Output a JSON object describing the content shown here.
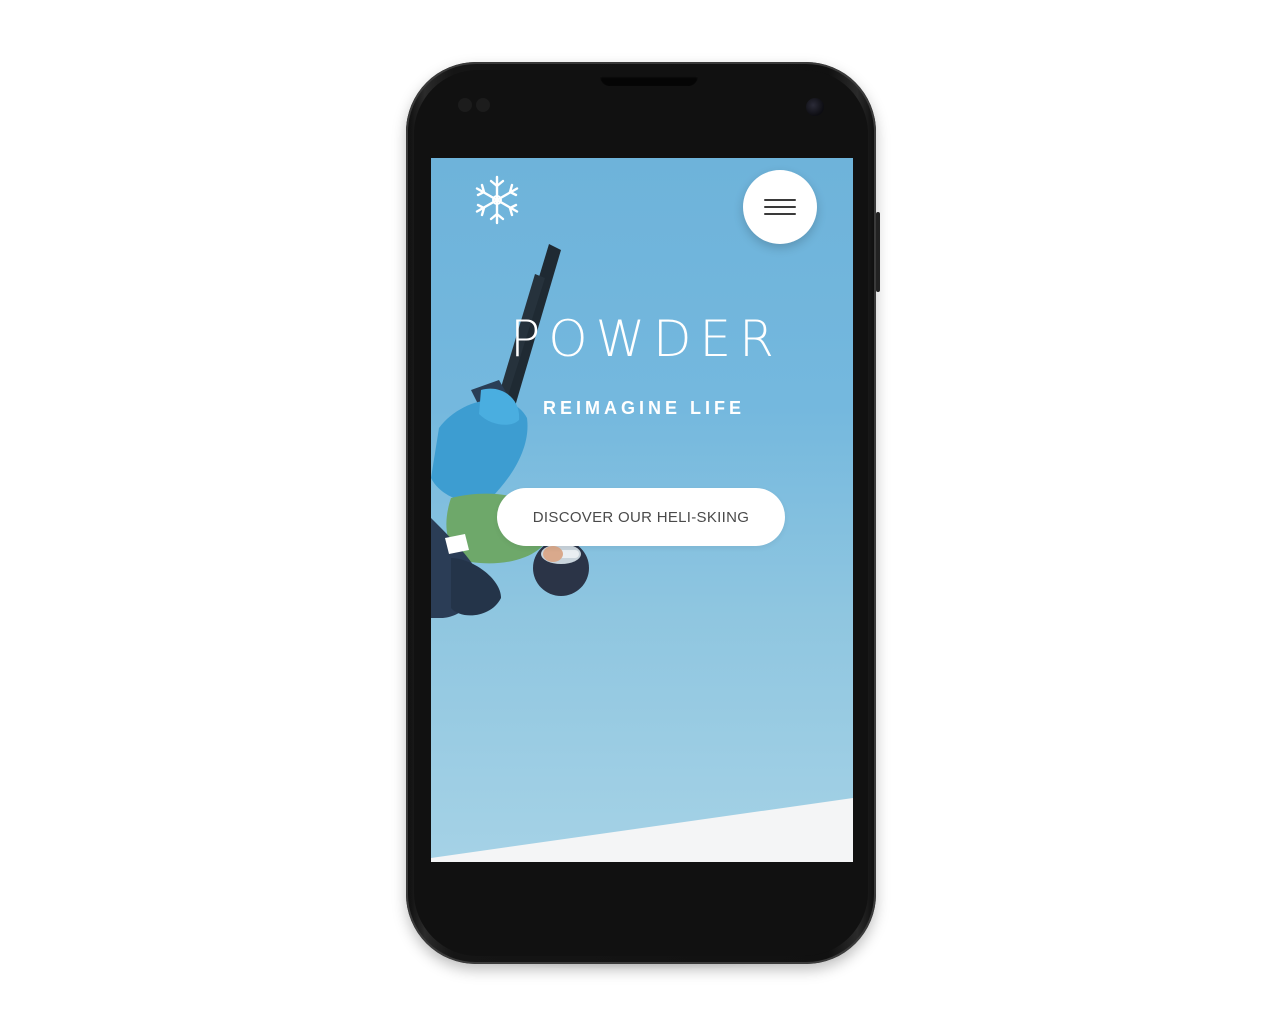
{
  "hero": {
    "title": "POWDER",
    "subtitle": "REIMAGINE LIFE",
    "cta_label": "DISCOVER OUR HELI-SKIING"
  },
  "icons": {
    "logo": "snowflake-icon",
    "menu": "hamburger-menu-icon"
  },
  "colors": {
    "sky": "#74b8de",
    "button_bg": "#ffffff",
    "button_text": "#4a4a4a",
    "text": "#ffffff"
  }
}
